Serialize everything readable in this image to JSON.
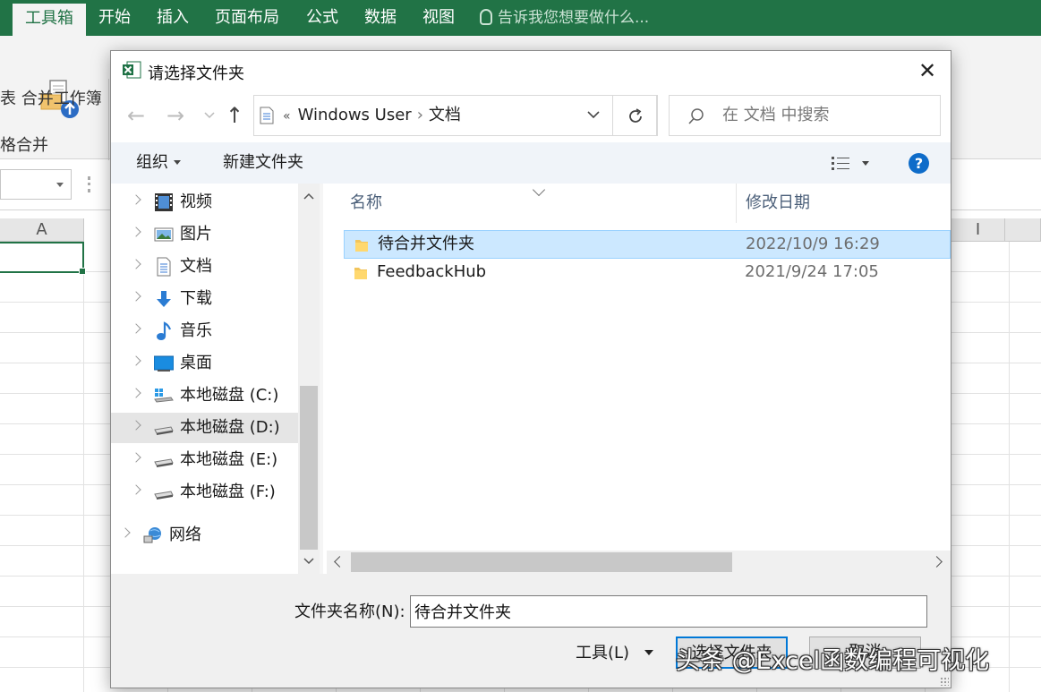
{
  "excel": {
    "ribbon_tabs": [
      "工具箱",
      "开始",
      "插入",
      "页面布局",
      "公式",
      "数据",
      "视图"
    ],
    "tell_me": "告诉我您想要做什么...",
    "merge_button_label": "表 合并工作簿",
    "group_label": "格合并",
    "column_a": "A",
    "column_i": "I",
    "accent_color": "#217346"
  },
  "dialog": {
    "title": "请选择文件夹",
    "address": {
      "overflow": "«",
      "crumbs": [
        "Windows User",
        "文档"
      ]
    },
    "search_placeholder": "在 文档 中搜索",
    "toolbar": {
      "organize": "组织",
      "new_folder": "新建文件夹",
      "help": "?"
    },
    "nav_items": [
      {
        "label": "视频",
        "icon": "video-icon"
      },
      {
        "label": "图片",
        "icon": "pictures-icon"
      },
      {
        "label": "文档",
        "icon": "documents-icon"
      },
      {
        "label": "下载",
        "icon": "download-icon"
      },
      {
        "label": "音乐",
        "icon": "music-icon"
      },
      {
        "label": "桌面",
        "icon": "desktop-icon"
      },
      {
        "label": "本地磁盘 (C:)",
        "icon": "drive-c-icon"
      },
      {
        "label": "本地磁盘 (D:)",
        "icon": "drive-icon"
      },
      {
        "label": "本地磁盘 (E:)",
        "icon": "drive-icon"
      },
      {
        "label": "本地磁盘 (F:)",
        "icon": "drive-icon"
      },
      {
        "label": "网络",
        "icon": "network-icon"
      }
    ],
    "columns": {
      "name": "名称",
      "modified": "修改日期"
    },
    "files": [
      {
        "name": "待合并文件夹",
        "modified": "2022/10/9 16:29",
        "selected": true
      },
      {
        "name": "FeedbackHub",
        "modified": "2021/9/24 17:05",
        "selected": false
      }
    ],
    "folder_name_label": "文件夹名称(N):",
    "folder_name_value": "待合并文件夹",
    "tools_label": "工具(L)",
    "select_button": "选择文件夹",
    "cancel_button": "取消"
  },
  "watermark": "头条 @Excel函数编程可视化"
}
